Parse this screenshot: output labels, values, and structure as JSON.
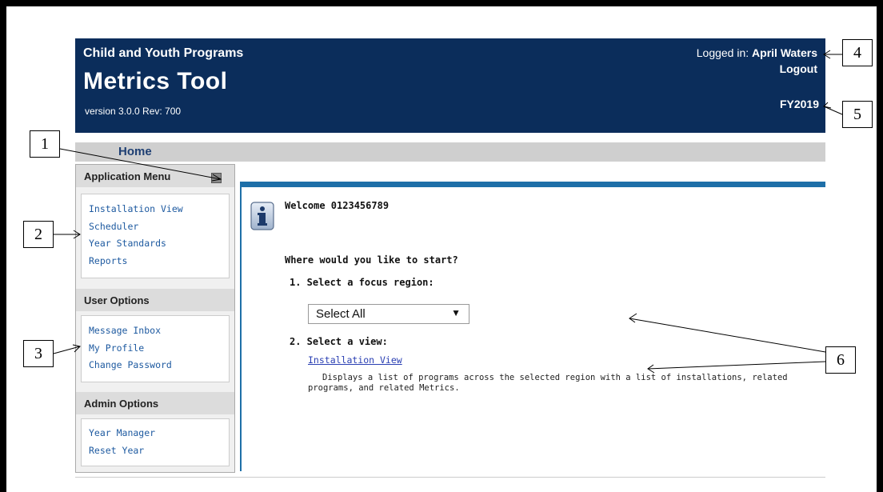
{
  "header": {
    "org": "Child and Youth Programs",
    "title": "Metrics Tool",
    "version": "version 3.0.0 Rev: 700",
    "logged_in_label": "Logged in:",
    "user": "April Waters",
    "logout": "Logout",
    "fiscal_year": "FY2019"
  },
  "nav": {
    "home": "Home"
  },
  "sidebar": {
    "application_menu": {
      "title": "Application Menu",
      "items": [
        "Installation View",
        "Scheduler",
        "Year Standards",
        "Reports"
      ]
    },
    "user_options": {
      "title": "User Options",
      "items": [
        "Message Inbox",
        "My Profile",
        "Change Password"
      ]
    },
    "admin_options": {
      "title": "Admin Options",
      "items": [
        "Year Manager",
        "Reset Year"
      ]
    }
  },
  "main": {
    "welcome": "Welcome 0123456789",
    "question": "Where would you like to start?",
    "step1": "1. Select a focus region:",
    "region_selected": "Select All",
    "step2": "2. Select a view:",
    "view_link": "Installation View",
    "view_description": "Displays a list of programs across the selected region with a list of installations, related programs, and related Metrics."
  },
  "callouts": [
    "1",
    "2",
    "3",
    "4",
    "5",
    "6"
  ],
  "colors": {
    "header_bg": "#0b2d5b",
    "accent": "#1e6fa8",
    "link": "#1e5aa0"
  }
}
